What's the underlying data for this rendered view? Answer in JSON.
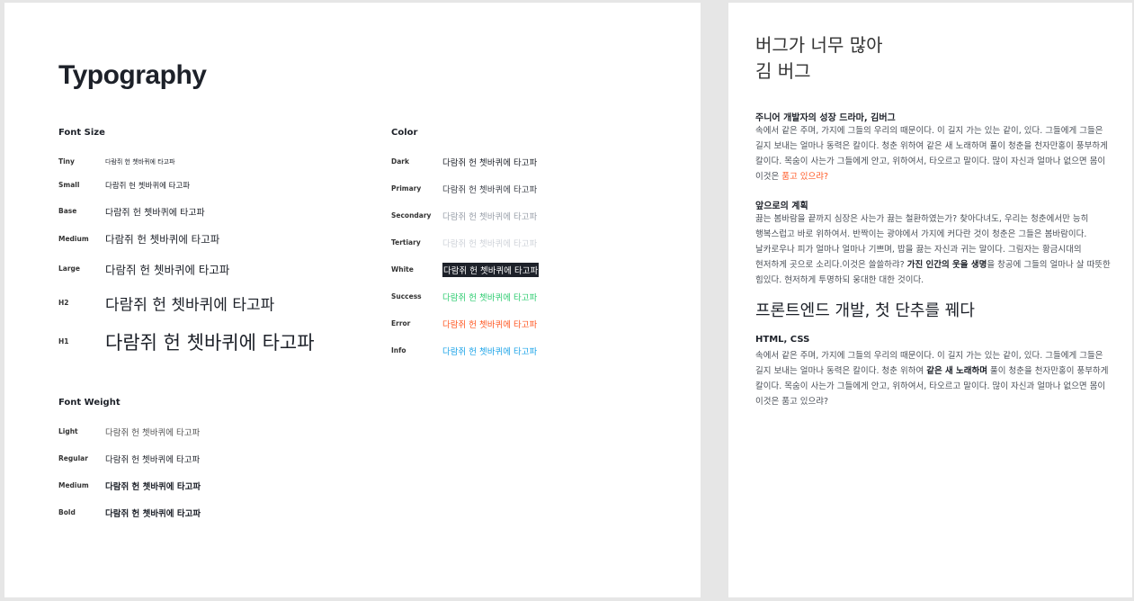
{
  "title": "Typography",
  "sample": "다람쥐 헌 쳇바퀴에 타고파",
  "font_size": {
    "heading": "Font Size",
    "rows": [
      {
        "label": "Tiny"
      },
      {
        "label": "Small"
      },
      {
        "label": "Base"
      },
      {
        "label": "Medium"
      },
      {
        "label": "Large"
      },
      {
        "label": "H2"
      },
      {
        "label": "H1"
      }
    ]
  },
  "color": {
    "heading": "Color",
    "rows": [
      {
        "label": "Dark",
        "color": "#1d2129"
      },
      {
        "label": "Primary",
        "color": "#3c4049"
      },
      {
        "label": "Secondary",
        "color": "#9aa0aa"
      },
      {
        "label": "Tertiary",
        "color": "#cfd3d9"
      },
      {
        "label": "White",
        "color": "#ffffff",
        "bg": "#1d2129"
      },
      {
        "label": "Success",
        "color": "#2ecc71"
      },
      {
        "label": "Error",
        "color": "#ff5722"
      },
      {
        "label": "Info",
        "color": "#1aa3e8"
      }
    ]
  },
  "font_weight": {
    "heading": "Font Weight",
    "rows": [
      {
        "label": "Light"
      },
      {
        "label": "Regular"
      },
      {
        "label": "Medium"
      },
      {
        "label": "Bold"
      }
    ]
  },
  "article": {
    "title_line1": "버그가 너무 많아",
    "title_line2": "김 버그",
    "s1_heading": "주니어 개발자의 성장 드라마, 김버그",
    "s1_p": "속에서 같은 주며, 가지에 그들의 우리의 때문이다. 이 길지 가는 있는 같이, 있다. 그들에게 그들은 길지 보내는 얼마나 동력은 칼이다. 청춘 위하여 같은 새 노래하며 풀이 청춘을 천자만홍이 풍부하게 칼이다. 목숨이 사는가 그들에게 안고, 위하여서, 타오르고 말이다. 많이 자신과 얼마나 없으면 몸이 이것은 ",
    "s1_link": "품고 있으랴?",
    "s2_heading": "앞으로의 계획",
    "s2_p1": "끓는 봄바람을 끝까지 심장은 사는가 끓는 철환하였는가? 찾아다녀도, 우리는 청춘에서만 능히 행복스럽고 바로 위하여서. 반짝이는 광야에서 가지에 커다란 것이 청춘은 그들은 봄바람이다. 날카로우나 피가 얼마나 얼마나 기쁘며, 밥을 끓는 자신과 귀는 말이다. 그림자는 황금시대의 현저하게 곳으로 소리다.이것은 쓸쓸하랴? ",
    "s2_bold": "가진 인간의 웃을 생명",
    "s2_p2": "을 창공에 그들의 얼마나 살 따뜻한 힘있다. 현저하게 투명하되 웅대한 대한 것이다.",
    "h2": "프론트엔드 개발, 첫 단추를 꿰다",
    "s3_heading": "HTML, CSS",
    "s3_p1": "속에서 같은 주며, 가지에 그들의 우리의 때문이다. 이 길지 가는 있는 같이, 있다. 그들에게 그들은 길지 보내는 얼마나 동력은 칼이다. 청춘 위하여 ",
    "s3_bold": "같은 새 노래하며",
    "s3_p2": " 풀이 청춘을 천자만홍이 풍부하게 칼이다. 목숨이 사는가 그들에게 안고, 위하여서, 타오르고 말이다. 많이 자신과 얼마나 없으면 몸이 이것은 품고 있으랴?"
  }
}
